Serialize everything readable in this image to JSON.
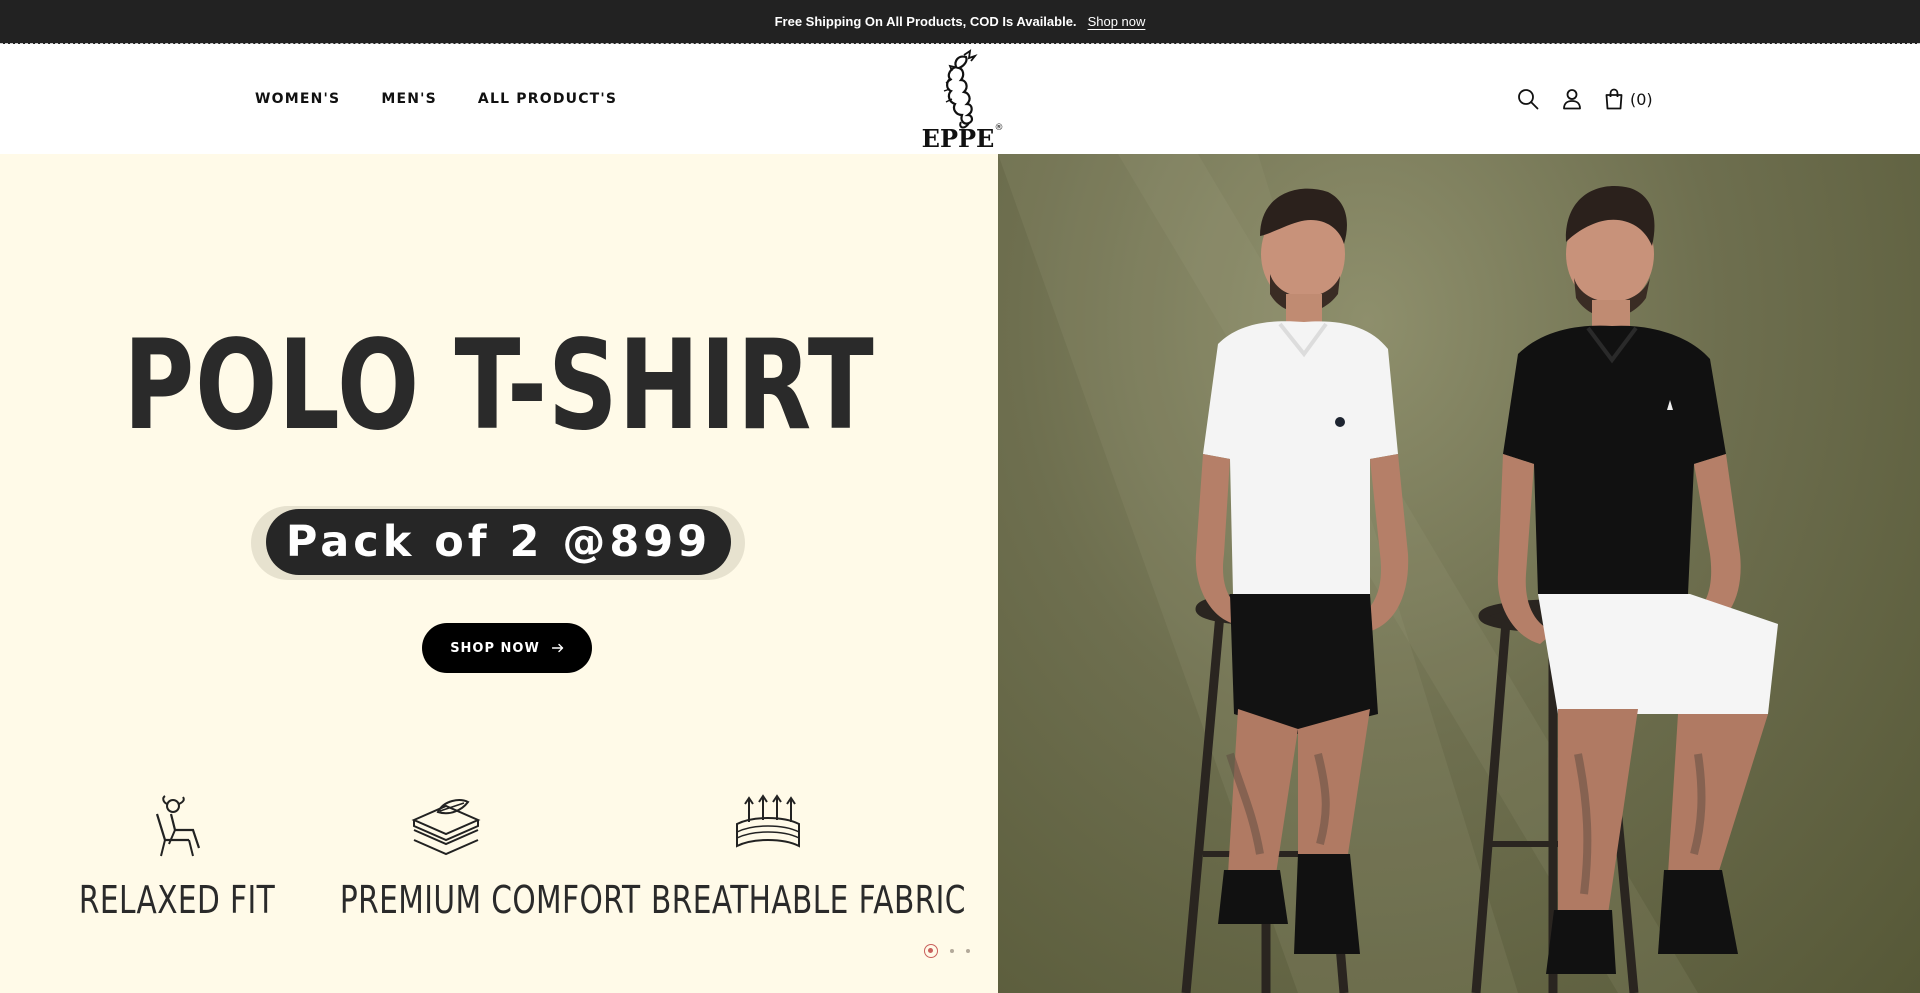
{
  "announcement": {
    "text": "Free Shipping On All Products, COD Is Available.",
    "link": "Shop now"
  },
  "nav": {
    "items": [
      "WOMEN'S",
      "MEN'S",
      "ALL PRODUCT'S"
    ]
  },
  "brand": {
    "name": "EPPE",
    "mark": "®"
  },
  "header": {
    "cart_count": "(0)"
  },
  "hero": {
    "title": "POLO T-SHIRT",
    "offer": "Pack of 2 @899",
    "cta": "SHOP NOW",
    "features": [
      "RELAXED FIT",
      "PREMIUM COMFORT",
      "BREATHABLE FABRIC"
    ],
    "slide_count": 3,
    "active_slide": 1
  },
  "colors": {
    "announcement_bg": "#222222",
    "hero_left_bg": "#fffae8",
    "offer_pill": "#262626",
    "cta_bg": "#000000",
    "photo_bg": "#6e6f4f",
    "dot_active": "#c9605c"
  },
  "icons": {
    "search": "search-icon",
    "account": "user-icon",
    "cart": "shopping-bag-icon",
    "features": [
      "lounge-chair-icon",
      "layered-fabric-icon",
      "breathable-fabric-icon"
    ]
  }
}
